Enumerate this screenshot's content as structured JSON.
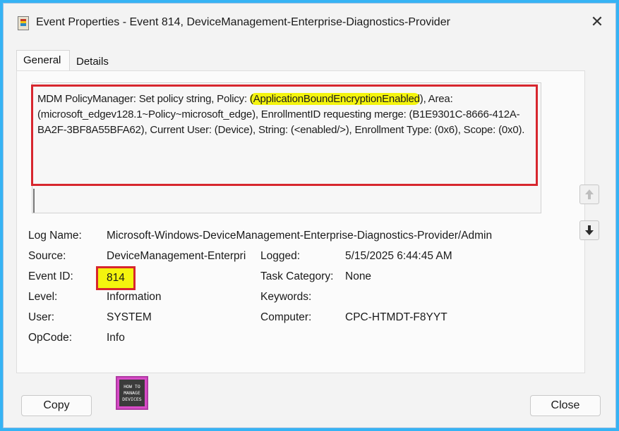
{
  "window": {
    "title": "Event Properties - Event 814, DeviceManagement-Enterprise-Diagnostics-Provider",
    "close_glyph": "✕"
  },
  "tabs": [
    {
      "label": "General",
      "active": true
    },
    {
      "label": "Details",
      "active": false
    }
  ],
  "message": {
    "before": "MDM PolicyManager: Set policy string, Policy: ",
    "highlight": "(ApplicationBoundEncryptionEnabled",
    "after": "), Area: (microsoft_edgev128.1~Policy~microsoft_edge), EnrollmentID requesting merge: (B1E9301C-8666-412A-BA2F-3BF8A55BFA62), Current User: (Device), String: (<enabled/>), Enrollment Type: (0x6), Scope: (0x0)."
  },
  "fields": {
    "log_name": {
      "label": "Log Name:",
      "value": "Microsoft-Windows-DeviceManagement-Enterprise-Diagnostics-Provider/Admin"
    },
    "source": {
      "label": "Source:",
      "value": "DeviceManagement-Enterpri"
    },
    "logged": {
      "label": "Logged:",
      "value": "5/15/2025 6:44:45 AM"
    },
    "event_id": {
      "label": "Event ID:",
      "value": "814"
    },
    "task_category": {
      "label": "Task Category:",
      "value": "None"
    },
    "level": {
      "label": "Level:",
      "value": "Information"
    },
    "keywords": {
      "label": "Keywords:",
      "value": ""
    },
    "user": {
      "label": "User:",
      "value": "SYSTEM"
    },
    "computer": {
      "label": "Computer:",
      "value": "CPC-HTMDT-F8YYT"
    },
    "opcode": {
      "label": "OpCode:",
      "value": "Info"
    }
  },
  "buttons": {
    "copy": "Copy",
    "close": "Close"
  },
  "icons": {
    "up": "arrow-up-icon",
    "down": "arrow-down-icon"
  },
  "logo": {
    "line1": "HOW TO",
    "line2": "MANAGE",
    "line3": "DEVICES"
  },
  "colors": {
    "highlight": "#f4f40e",
    "annotation_red": "#d7262e",
    "background": "#36b3f4"
  }
}
